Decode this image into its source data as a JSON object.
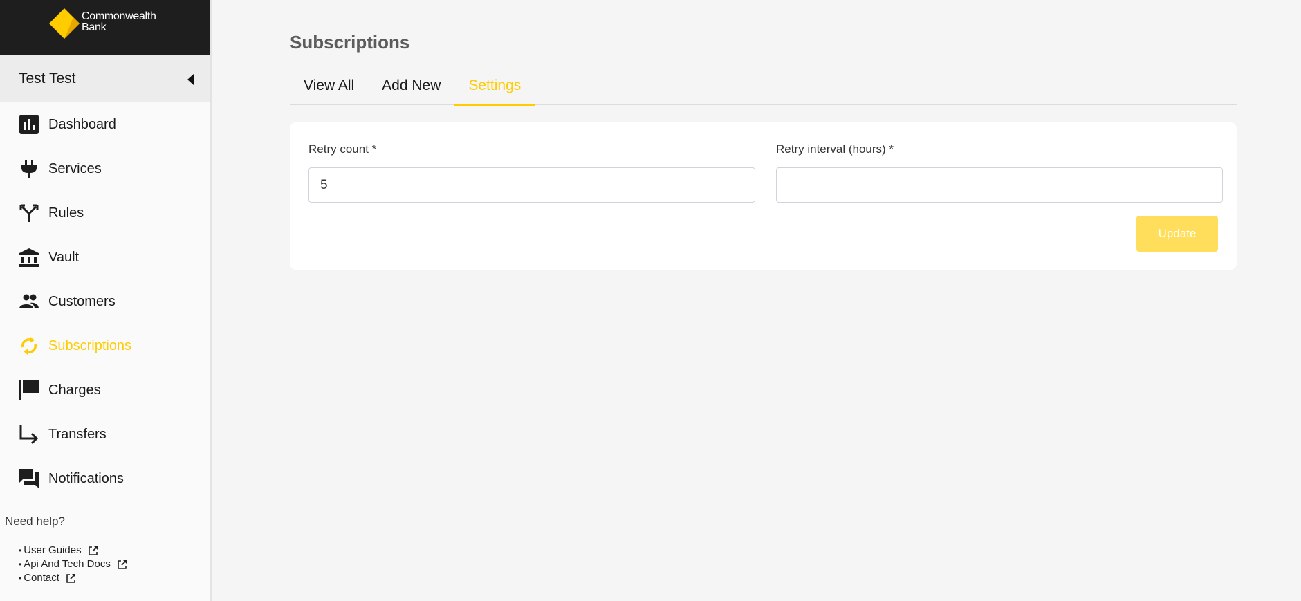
{
  "brand": {
    "name_line1": "Commonwealth",
    "name_line2": "Bank",
    "accent": "#ffcc00"
  },
  "user": {
    "name": "Test Test"
  },
  "sidebar": {
    "items": [
      {
        "label": "Dashboard",
        "icon": "dashboard-icon",
        "active": false
      },
      {
        "label": "Services",
        "icon": "plug-icon",
        "active": false
      },
      {
        "label": "Rules",
        "icon": "fork-icon",
        "active": false
      },
      {
        "label": "Vault",
        "icon": "bank-icon",
        "active": false
      },
      {
        "label": "Customers",
        "icon": "people-icon",
        "active": false
      },
      {
        "label": "Subscriptions",
        "icon": "refresh-icon",
        "active": true
      },
      {
        "label": "Charges",
        "icon": "flag-icon",
        "active": false
      },
      {
        "label": "Transfers",
        "icon": "turn-arrow-icon",
        "active": false
      },
      {
        "label": "Notifications",
        "icon": "chat-icon",
        "active": false
      }
    ]
  },
  "help": {
    "title": "Need help?",
    "links": [
      {
        "label": "User Guides"
      },
      {
        "label": "Api And Tech Docs"
      },
      {
        "label": "Contact"
      }
    ]
  },
  "page": {
    "title": "Subscriptions",
    "tabs": [
      {
        "label": "View All",
        "active": false
      },
      {
        "label": "Add New",
        "active": false
      },
      {
        "label": "Settings",
        "active": true
      }
    ]
  },
  "form": {
    "retry_count": {
      "label": "Retry count *",
      "value": "5",
      "placeholder": ""
    },
    "retry_interval": {
      "label": "Retry interval (hours) *",
      "value": "",
      "placeholder": ""
    },
    "update_label": "Update",
    "update_color": "#ffde5c"
  }
}
